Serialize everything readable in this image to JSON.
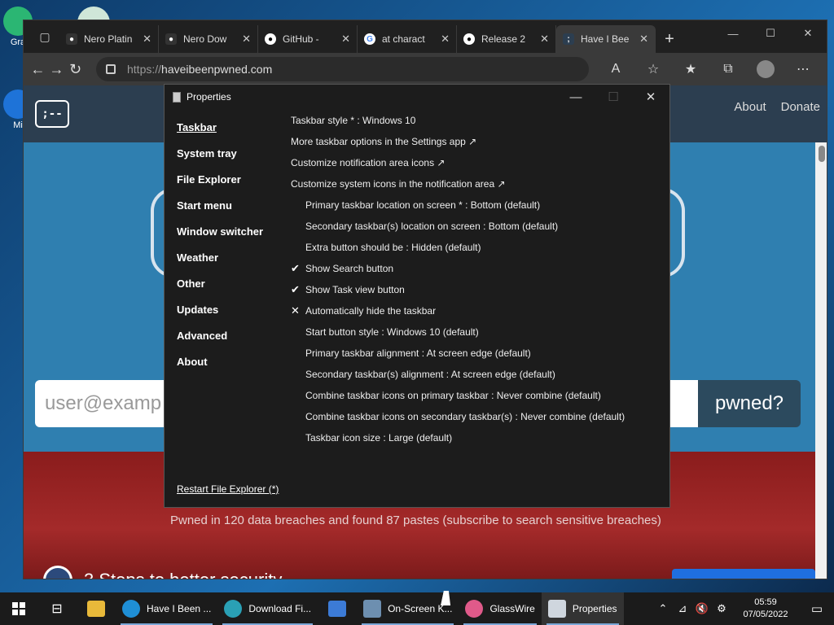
{
  "desktop": {
    "icons": [
      {
        "label": "Gra",
        "color": "#2bb673"
      },
      {
        "label": "Mi",
        "color": "#1e73d8"
      }
    ]
  },
  "browser": {
    "tabs": [
      {
        "label": "Nero Platin",
        "favicon": "github-icon",
        "active": false
      },
      {
        "label": "Nero Dow",
        "favicon": "github-icon",
        "active": false
      },
      {
        "label": "GitHub - ",
        "favicon": "github-icon",
        "active": false
      },
      {
        "label": "at charact",
        "favicon": "google-icon",
        "active": false
      },
      {
        "label": "Release 2",
        "favicon": "github-icon",
        "active": false
      },
      {
        "label": "Have I Bee",
        "favicon": "hibp-icon",
        "active": true
      }
    ],
    "url_protocol": "https://",
    "url_host": "haveibeenpwned.com",
    "tab_close_glyph": "✕",
    "new_tab_glyph": "+"
  },
  "site": {
    "nav": [
      "About",
      "Donate"
    ],
    "logo_text": ";--",
    "search_placeholder": "user@examp",
    "search_button": "pwned?",
    "pwned_summary": "Pwned in 120 data breaches and found 87 pastes (subscribe to search sensitive breaches)",
    "steps_text": "3 Steps to better security"
  },
  "properties": {
    "title": "Properties",
    "sidebar": [
      {
        "label": "Taskbar",
        "active": true
      },
      {
        "label": "System tray",
        "active": false
      },
      {
        "label": "File Explorer",
        "active": false
      },
      {
        "label": "Start menu",
        "active": false
      },
      {
        "label": "Window switcher",
        "active": false
      },
      {
        "label": "Weather",
        "active": false
      },
      {
        "label": "Other",
        "active": false
      },
      {
        "label": "Updates",
        "active": false
      },
      {
        "label": "Advanced",
        "active": false
      },
      {
        "label": "About",
        "active": false
      }
    ],
    "options": [
      {
        "label": "Taskbar style * : Windows 10",
        "mark": "",
        "top": true
      },
      {
        "label": "More taskbar options in the Settings app ↗",
        "mark": "",
        "top": true
      },
      {
        "label": "Customize notification area icons ↗",
        "mark": "",
        "top": true
      },
      {
        "label": "Customize system icons in the notification area ↗",
        "mark": "",
        "top": true
      },
      {
        "label": "Primary taskbar location on screen * : Bottom (default)",
        "mark": "",
        "top": false
      },
      {
        "label": "Secondary taskbar(s) location on screen : Bottom (default)",
        "mark": "",
        "top": false
      },
      {
        "label": "Extra button should be : Hidden (default)",
        "mark": "",
        "top": false
      },
      {
        "label": "Show Search button",
        "mark": "✔",
        "top": false
      },
      {
        "label": "Show Task view button",
        "mark": "✔",
        "top": false
      },
      {
        "label": "Automatically hide the taskbar",
        "mark": "✕",
        "top": false
      },
      {
        "label": "Start button style : Windows 10 (default)",
        "mark": "",
        "top": false
      },
      {
        "label": "Primary taskbar alignment : At screen edge (default)",
        "mark": "",
        "top": false
      },
      {
        "label": "Secondary taskbar(s) alignment : At screen edge (default)",
        "mark": "",
        "top": false
      },
      {
        "label": "Combine taskbar icons on primary taskbar : Never combine (default)",
        "mark": "",
        "top": false
      },
      {
        "label": "Combine taskbar icons on secondary taskbar(s) : Never combine (default)",
        "mark": "",
        "top": false
      },
      {
        "label": "Taskbar icon size : Large (default)",
        "mark": "",
        "top": false
      }
    ],
    "restart_link": "Restart File Explorer (*)"
  },
  "taskbar": {
    "apps": [
      {
        "label": "Have I Been ...",
        "icon": "edge-icon",
        "color": "#1f8fd6",
        "active": false,
        "open": true
      },
      {
        "label": "Download Fi...",
        "icon": "edge-icon",
        "color": "#2aa0b5",
        "active": false,
        "open": true
      },
      {
        "label": "On-Screen K...",
        "icon": "keyboard-icon",
        "color": "#6d8fb0",
        "active": false,
        "open": true
      },
      {
        "label": "GlassWire",
        "icon": "glasswire-icon",
        "color": "#e05a8a",
        "active": false,
        "open": true
      },
      {
        "label": "Properties",
        "icon": "properties-icon",
        "color": "#cfd6de",
        "active": true,
        "open": true
      }
    ],
    "time": "05:59",
    "date": "07/05/2022"
  }
}
